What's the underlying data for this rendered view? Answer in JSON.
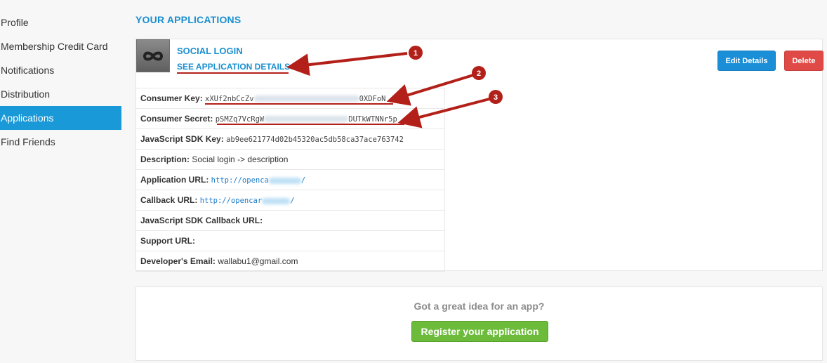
{
  "sidebar": {
    "items": [
      {
        "label": "Profile"
      },
      {
        "label": "Membership Credit Card"
      },
      {
        "label": "Notifications"
      },
      {
        "label": "Distribution"
      },
      {
        "label": "Applications"
      },
      {
        "label": "Find Friends"
      }
    ],
    "active_index": 4
  },
  "page": {
    "section_title": "YOUR APPLICATIONS"
  },
  "app": {
    "icon": "infinity-icon",
    "name": "SOCIAL LOGIN",
    "see_details": "SEE APPLICATION DETAILS",
    "edit_label": "Edit Details",
    "delete_label": "Delete",
    "fields": {
      "consumer_key": {
        "label": "Consumer Key:",
        "value_start": "xXUf2nbCcZv",
        "value_end": "0XDFoN"
      },
      "consumer_secret": {
        "label": "Consumer Secret:",
        "value_start": "pSMZq7VcRgW",
        "value_end": "DUTkWTNNr5p"
      },
      "js_sdk_key": {
        "label": "JavaScript SDK Key:",
        "value": "ab9ee621774d02b45320ac5db58ca37ace763742"
      },
      "description": {
        "label": "Description:",
        "value": "Social login -> description"
      },
      "application_url": {
        "label": "Application URL:",
        "value_start": "http://openca",
        "value_end": "/"
      },
      "callback_url": {
        "label": "Callback URL:",
        "value_start": "http://opencar",
        "value_end": "/"
      },
      "js_sdk_callback_url": {
        "label": "JavaScript SDK Callback URL:"
      },
      "support_url": {
        "label": "Support URL:"
      },
      "developer_email": {
        "label": "Developer's Email:",
        "value": "wallabu1@gmail.com"
      }
    }
  },
  "idea": {
    "text": "Got a great idea for an app?",
    "register_label": "Register your application"
  },
  "annotations": [
    {
      "number": "1"
    },
    {
      "number": "2"
    },
    {
      "number": "3"
    }
  ],
  "colors": {
    "accent": "#1a8fd0",
    "active_nav": "#1a99d8",
    "delete": "#e04a46",
    "register": "#6cbb3a",
    "annotation": "#b3201a"
  }
}
